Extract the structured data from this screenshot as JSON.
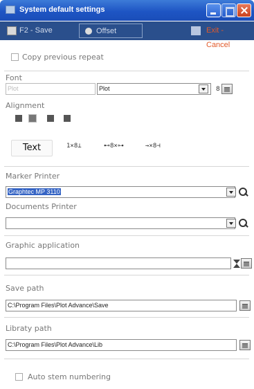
{
  "window": {
    "title": "System default settings"
  },
  "toolbar": {
    "save_label": "F2 - Save",
    "offset_label": "Offset",
    "exit_label": "Exit - Cancel"
  },
  "copy_previous_repeat": {
    "label": "Copy previous repeat",
    "checked": false
  },
  "font": {
    "label": "Font",
    "name_value": "Plot",
    "family_value": "Plot",
    "size_value": "8"
  },
  "alignment": {
    "label": "Alignment",
    "options": [
      "align-left",
      "align-center",
      "align-right",
      "align-justify"
    ],
    "selected": "align-center"
  },
  "text_position": {
    "text_label": "Text",
    "opt_above": "1×8⊥",
    "opt_middle": "⊷8×⊶",
    "opt_right": "→×8⊣"
  },
  "marker_printer": {
    "label": "Marker Printer",
    "value": "Graphtec MP 3110"
  },
  "documents_printer": {
    "label": "Documents Printer",
    "value": ""
  },
  "graphic_application": {
    "label": "Graphic application",
    "value": ""
  },
  "save_path": {
    "label": "Save path",
    "value": "C:\\Program Files\\Plot Advance\\Save"
  },
  "library_path": {
    "label": "Libraty path",
    "value": "C:\\Program Files\\Plot Advance\\Lib"
  },
  "auto_stem": {
    "label": "Auto stem numbering",
    "checked": false
  },
  "colors": {
    "title_bar": "#1e55c4",
    "toolbar": "#2a4f8c",
    "exit_text": "#e25a2a",
    "selection": "#3564c4"
  }
}
